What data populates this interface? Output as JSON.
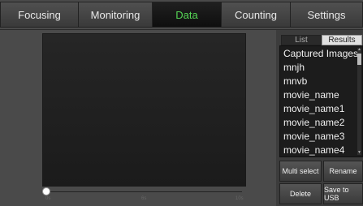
{
  "tabs": [
    {
      "label": "Focusing"
    },
    {
      "label": "Monitoring"
    },
    {
      "label": "Data",
      "active": true
    },
    {
      "label": "Counting"
    },
    {
      "label": "Settings"
    }
  ],
  "timeline": {
    "progress": 0,
    "labels": [
      "0s",
      "6s",
      "10s"
    ]
  },
  "panel": {
    "view_tabs": {
      "list": "List",
      "results": "Results",
      "selected": "Results"
    },
    "items": [
      "Captured Images",
      "mnjh",
      "mnvb",
      "movie_name",
      "movie_name1",
      "movie_name2",
      "movie_name3",
      "movie_name4"
    ],
    "buttons": {
      "multi_select": "Multi select",
      "rename": "Rename",
      "delete": "Delete",
      "save_to_usb": "Save to USB"
    }
  },
  "colors": {
    "active_tab_text": "#55d655",
    "background": "#444444",
    "list_background": "#1c1c1c"
  }
}
